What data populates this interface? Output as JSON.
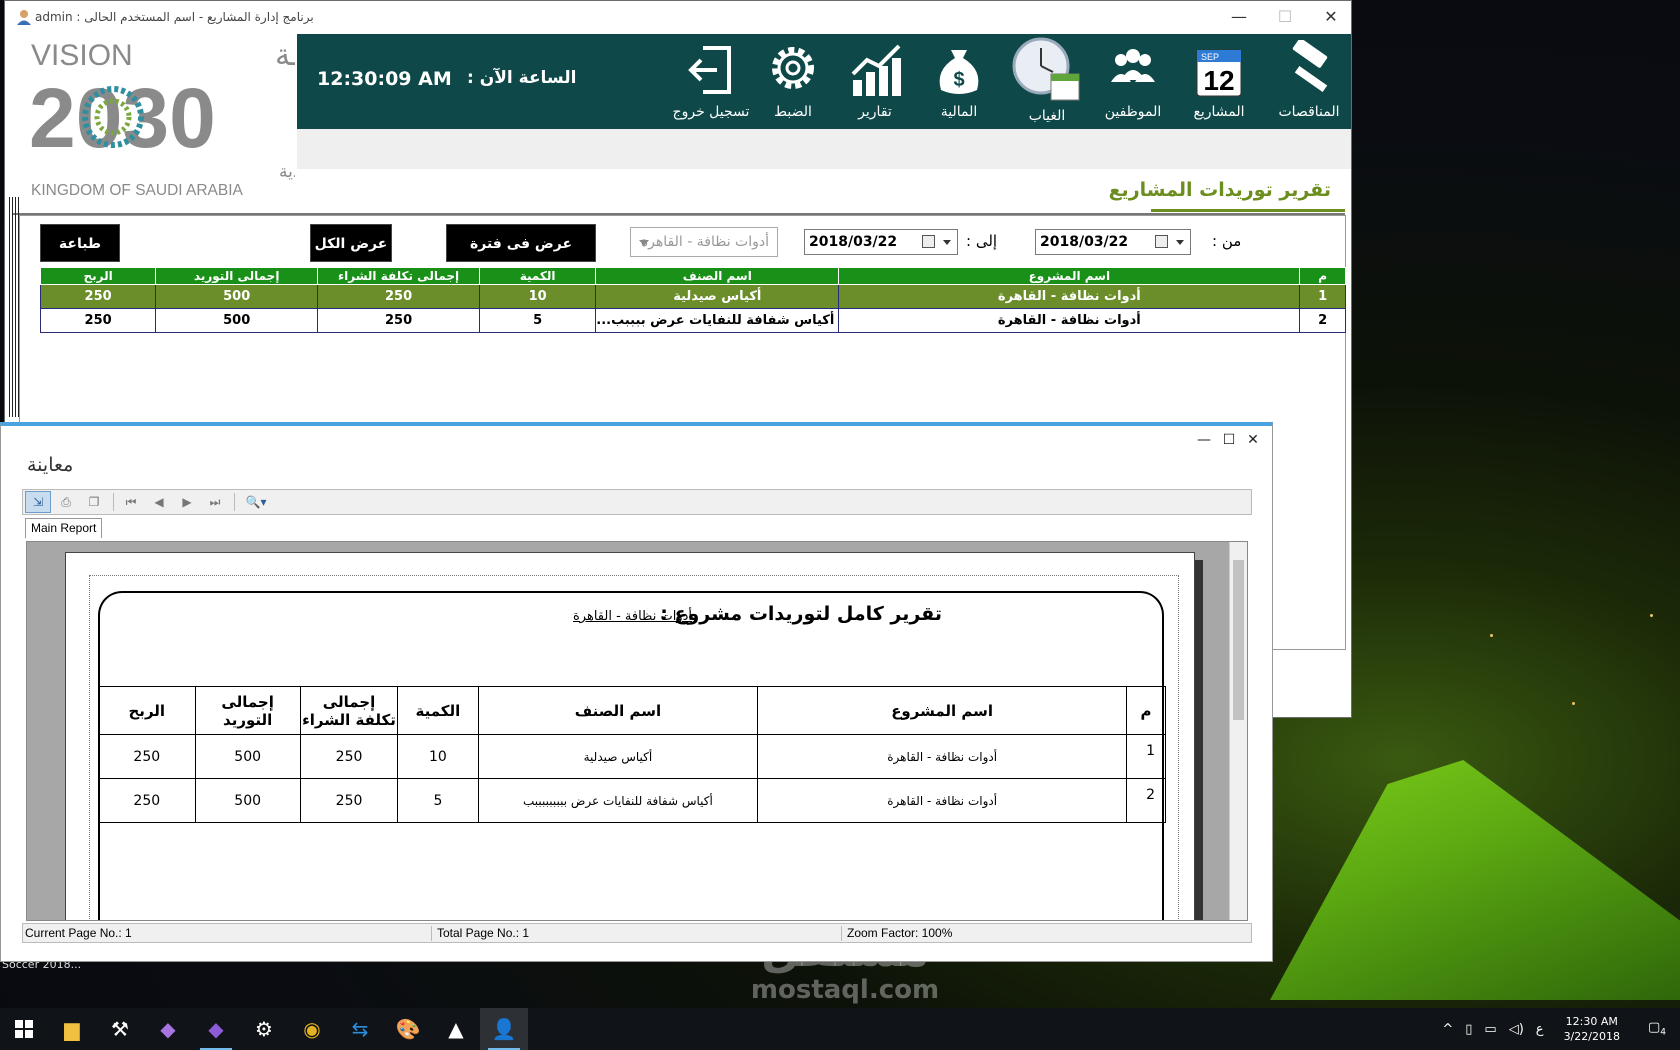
{
  "main_window": {
    "title": "برنامج إدارة المشاريع  -  اسم المستخدم الحالى  :  admin",
    "controls": {
      "minimize": "—",
      "maximize": "☐",
      "close": "✕"
    }
  },
  "logo": {
    "vision": "VISION",
    "arabic_vision": "رؤيـــة",
    "year": "2030",
    "kingdom_ar": "المملكة العربية السعودية",
    "kingdom_en": "KINGDOM OF SAUDI ARABIA"
  },
  "toolbar": {
    "clock_label": "الساعة الآن :",
    "clock_time": "12:30:09 AM",
    "items": [
      {
        "label": "المناقصات",
        "icon": "gavel-icon"
      },
      {
        "label": "المشاريع",
        "icon": "calendar-icon",
        "day": "12",
        "month": "SEP"
      },
      {
        "label": "الموظفين",
        "icon": "employees-icon"
      },
      {
        "label": "الغياب",
        "icon": "clock-calendar-icon"
      },
      {
        "label": "المالية",
        "icon": "money-bag-icon"
      },
      {
        "label": "تقارير",
        "icon": "chart-icon"
      },
      {
        "label": "الضبط",
        "icon": "gear-icon"
      },
      {
        "label": "تسجيل خروج",
        "icon": "logout-icon"
      }
    ]
  },
  "page": {
    "title": "تقرير توريدات المشاريع"
  },
  "filters": {
    "from_label": "من :",
    "from_date": "2018/03/22",
    "to_label": "إلى :",
    "to_date": "2018/03/22",
    "project_placeholder": "أدوات نظافة - القاهرة",
    "btn_period": "عرض فى فترة محددة",
    "btn_all": "عرض الكل",
    "btn_print": "طباعة"
  },
  "grid": {
    "columns": [
      "م",
      "اسم المشروع",
      "اسم الصنف",
      "الكمية",
      "إجمالى تكلفة الشراء",
      "إجمالى التوريد",
      "الربح"
    ],
    "rows": [
      [
        "1",
        "أدوات نظافة - القاهرة",
        "أكياس صيدلية",
        "10",
        "250",
        "500",
        "250"
      ],
      [
        "2",
        "أدوات نظافة - القاهرة",
        "أكياس شفافة للنفايات  عرض ببببب...",
        "5",
        "250",
        "500",
        "250"
      ]
    ]
  },
  "preview": {
    "title": "معاينة",
    "tab": "Main Report",
    "controls": {
      "minimize": "—",
      "maximize": "☐",
      "close": "✕"
    },
    "report_title": "تقرير كامل لتوريدات مشروع :",
    "report_project": "أدوات نظافة - القاهرة",
    "columns": [
      "م",
      "اسم المشروع",
      "اسم الصنف",
      "الكمية",
      "إجمالى تكلفة الشراء",
      "إجمالى التوريد",
      "الربح"
    ],
    "rows": [
      [
        "1",
        "أدوات نظافة - القاهرة",
        "أكياس صيدلية",
        "10",
        "250",
        "500",
        "250"
      ],
      [
        "2",
        "أدوات نظافة - القاهرة",
        "أكياس شفافة للنفايات  عرض بببببببببب",
        "5",
        "250",
        "500",
        "250"
      ]
    ],
    "status": {
      "current_page": "Current Page No.: 1",
      "total_pages": "Total Page No.: 1",
      "zoom": "Zoom Factor: 100%"
    }
  },
  "desktop": {
    "label": "Soccer 2018...",
    "watermark_ar": "مستقل",
    "watermark_en": "mostaql.com"
  },
  "taskbar": {
    "time": "12:30 AM",
    "date": "3/22/2018",
    "lang": "ع",
    "notifications": "4"
  }
}
